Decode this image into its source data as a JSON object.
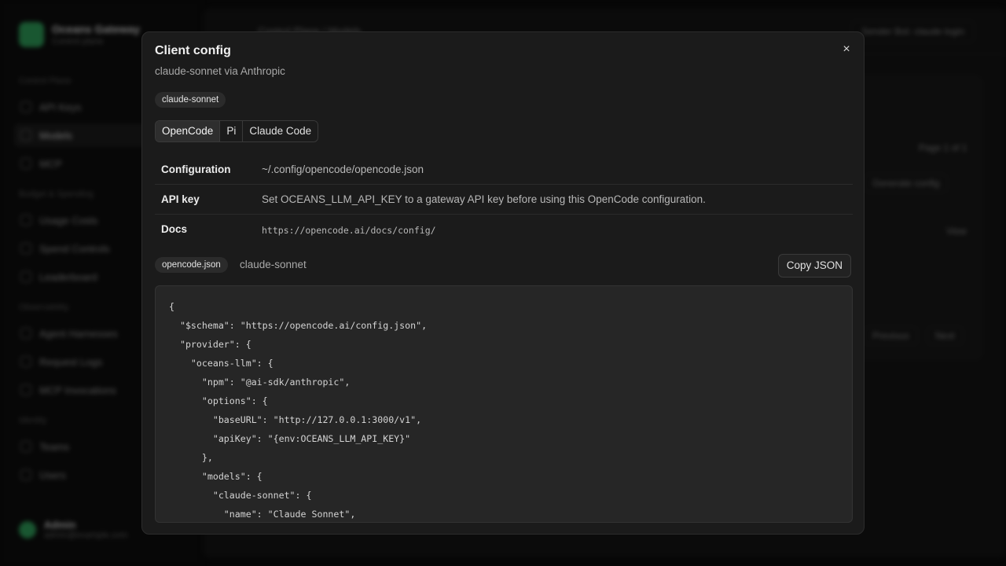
{
  "background": {
    "brand": {
      "name": "Oceans Gateway",
      "subtitle": "Control plane"
    },
    "nav_groups": [
      "Control Plane",
      "Budget & Spending",
      "Observability",
      "Identity"
    ],
    "nav_items": [
      "API Keys",
      "Models",
      "MCP",
      "Usage Costs",
      "Spend Controls",
      "Leaderboard",
      "Agent Harnesses",
      "Request Logs",
      "MCP Invocations",
      "Teams",
      "Users"
    ],
    "breadcrumb": "Control Plane  /  Models",
    "top_right": "Sender Bot: claude login",
    "page_label": "Page 1 of 1",
    "generate_config": "Generate config",
    "view": "View",
    "previous": "Previous",
    "next": "Next",
    "user": {
      "name": "Admin",
      "email": "admin@example.com"
    }
  },
  "modal": {
    "title": "Client config",
    "subtitle": "claude-sonnet via Anthropic",
    "model_badge": "claude-sonnet",
    "close_icon": "×",
    "tabs": [
      {
        "label": "OpenCode",
        "active": true
      },
      {
        "label": "Pi",
        "active": false
      },
      {
        "label": "Claude Code",
        "active": false
      }
    ],
    "info": {
      "config_label": "Configuration",
      "config_value": "~/.config/opencode/opencode.json",
      "apikey_label": "API key",
      "apikey_value": "Set OCEANS_LLM_API_KEY to a gateway API key before using this OpenCode configuration.",
      "docs_label": "Docs",
      "docs_value": "https://opencode.ai/docs/config/"
    },
    "file_badge": "opencode.json",
    "file_model": "claude-sonnet",
    "copy_label": "Copy JSON",
    "code_lines": [
      "{",
      "  \"$schema\": \"https://opencode.ai/config.json\",",
      "  \"provider\": {",
      "    \"oceans-llm\": {",
      "      \"npm\": \"@ai-sdk/anthropic\",",
      "      \"options\": {",
      "        \"baseURL\": \"http://127.0.0.1:3000/v1\",",
      "        \"apiKey\": \"{env:OCEANS_LLM_API_KEY}\"",
      "      },",
      "      \"models\": {",
      "        \"claude-sonnet\": {",
      "          \"name\": \"Claude Sonnet\","
    ]
  }
}
